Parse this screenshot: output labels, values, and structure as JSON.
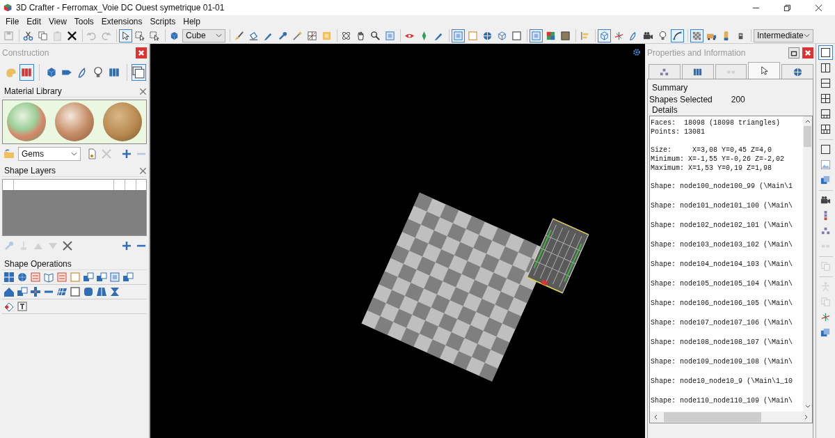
{
  "window": {
    "title": "3D Crafter - Ferromax_Voie DC Ouest symetrique 01-01"
  },
  "menu": [
    {
      "label": "File"
    },
    {
      "label": "Edit"
    },
    {
      "label": "View"
    },
    {
      "label": "Tools"
    },
    {
      "label": "Extensions"
    },
    {
      "label": "Scripts"
    },
    {
      "label": "Help"
    }
  ],
  "toolbar": [
    {
      "kind": "button",
      "selected": false,
      "disabled": true
    },
    {
      "kind": "separator"
    },
    {
      "kind": "button",
      "selected": false,
      "disabled": false
    },
    {
      "kind": "button",
      "selected": false,
      "disabled": false
    },
    {
      "kind": "button",
      "selected": false,
      "disabled": true
    },
    {
      "kind": "button",
      "selected": false,
      "disabled": false
    },
    {
      "kind": "separator"
    },
    {
      "kind": "button",
      "selected": false,
      "disabled": true
    },
    {
      "kind": "button",
      "selected": false,
      "disabled": true
    },
    {
      "kind": "separator"
    },
    {
      "kind": "button",
      "selected": true,
      "disabled": false
    },
    {
      "kind": "button",
      "selected": false,
      "disabled": false
    },
    {
      "kind": "button",
      "selected": false,
      "disabled": false
    },
    {
      "kind": "separator"
    },
    {
      "kind": "button",
      "selected": false,
      "disabled": false
    },
    {
      "kind": "dropdown",
      "value": "Cube"
    },
    {
      "kind": "separator"
    },
    {
      "kind": "button",
      "selected": false,
      "disabled": false
    },
    {
      "kind": "button",
      "selected": false,
      "disabled": false
    },
    {
      "kind": "button",
      "selected": false,
      "disabled": false
    },
    {
      "kind": "button",
      "selected": false,
      "disabled": false
    },
    {
      "kind": "button",
      "selected": false,
      "disabled": false
    },
    {
      "kind": "button",
      "selected": false,
      "disabled": false
    },
    {
      "kind": "button",
      "selected": false,
      "disabled": false
    },
    {
      "kind": "separator"
    },
    {
      "kind": "button",
      "selected": false,
      "disabled": false
    },
    {
      "kind": "button",
      "selected": false,
      "disabled": false
    },
    {
      "kind": "button",
      "selected": false,
      "disabled": false
    },
    {
      "kind": "button",
      "selected": false,
      "disabled": false
    },
    {
      "kind": "separator"
    },
    {
      "kind": "button",
      "selected": false,
      "disabled": false
    },
    {
      "kind": "button",
      "selected": false,
      "disabled": false
    },
    {
      "kind": "button",
      "selected": false,
      "disabled": false
    },
    {
      "kind": "separator"
    },
    {
      "kind": "button",
      "selected": true,
      "disabled": false
    },
    {
      "kind": "button",
      "selected": false,
      "disabled": false
    },
    {
      "kind": "button",
      "selected": false,
      "disabled": false
    },
    {
      "kind": "button",
      "selected": false,
      "disabled": false
    },
    {
      "kind": "button",
      "selected": false,
      "disabled": false
    },
    {
      "kind": "separator"
    },
    {
      "kind": "button",
      "selected": true,
      "disabled": false
    },
    {
      "kind": "button",
      "selected": false,
      "disabled": false
    },
    {
      "kind": "button",
      "selected": false,
      "disabled": false
    },
    {
      "kind": "separator"
    },
    {
      "kind": "button",
      "selected": false,
      "disabled": false
    },
    {
      "kind": "separator"
    },
    {
      "kind": "button",
      "selected": true,
      "disabled": false
    },
    {
      "kind": "button",
      "selected": false,
      "disabled": false
    },
    {
      "kind": "button",
      "selected": false,
      "disabled": false
    },
    {
      "kind": "button",
      "selected": false,
      "disabled": false
    },
    {
      "kind": "button",
      "selected": false,
      "disabled": false
    },
    {
      "kind": "button",
      "selected": true,
      "disabled": false
    },
    {
      "kind": "separator"
    },
    {
      "kind": "button",
      "selected": true,
      "disabled": false
    },
    {
      "kind": "button",
      "selected": false,
      "disabled": false
    },
    {
      "kind": "button",
      "selected": false,
      "disabled": false
    },
    {
      "kind": "button",
      "selected": false,
      "disabled": false
    },
    {
      "kind": "separator"
    },
    {
      "kind": "dropdown",
      "value": "Intermediate"
    }
  ],
  "construction": {
    "title": "Construction",
    "tools": [
      {
        "kind": "button",
        "selected": false
      },
      {
        "kind": "button",
        "selected": true
      },
      {
        "kind": "separator"
      },
      {
        "kind": "button",
        "selected": false
      },
      {
        "kind": "button",
        "selected": false
      },
      {
        "kind": "button",
        "selected": false
      },
      {
        "kind": "button",
        "selected": false
      },
      {
        "kind": "button",
        "selected": false
      },
      {
        "kind": "separator"
      },
      {
        "kind": "button",
        "selected": true
      }
    ],
    "material_library": {
      "title": "Material Library",
      "category": "Gems",
      "tools": [
        {
          "disabled": false
        },
        {
          "disabled": true
        },
        {
          "disabled": false
        },
        {
          "disabled": true
        }
      ]
    },
    "shape_layers": {
      "title": "Shape Layers",
      "tools": [
        {
          "disabled": true
        },
        {
          "disabled": true
        },
        {
          "disabled": true
        },
        {
          "disabled": true
        },
        {
          "disabled": false
        },
        {
          "disabled": false
        },
        {
          "disabled": false
        }
      ]
    },
    "shape_operations": {
      "title": "Shape Operations"
    }
  },
  "properties": {
    "title": "Properties and Information",
    "tabs": [
      {
        "selected": false,
        "disabled": false
      },
      {
        "selected": false,
        "disabled": false
      },
      {
        "selected": false,
        "disabled": true
      },
      {
        "selected": true,
        "disabled": false
      },
      {
        "selected": false,
        "disabled": false
      }
    ],
    "summary_label": "Summary",
    "shapes_selected_label": "Shapes Selected",
    "shapes_selected_value": "200",
    "details_label": "Details",
    "details": [
      {
        "lines": [
          "Faces:  18098 (18098 triangles)",
          "Points: 13081"
        ]
      },
      {
        "lines": [
          "Size:     X=3,08 Y=0,45 Z=4,0",
          "Minimum: X=-1,55 Y=-0,26 Z=-2,02",
          "Maximum: X=1,53 Y=0,19 Z=1,98"
        ]
      },
      {
        "lines": [
          "Shape: node100_node100_99 (\\Main\\1"
        ]
      },
      {
        "lines": [
          "Shape: node101_node101_100 (\\Main\\"
        ]
      },
      {
        "lines": [
          "Shape: node102_node102_101 (\\Main\\"
        ]
      },
      {
        "lines": [
          "Shape: node103_node103_102 (\\Main\\"
        ]
      },
      {
        "lines": [
          "Shape: node104_node104_103 (\\Main\\"
        ]
      },
      {
        "lines": [
          "Shape: node105_node105_104 (\\Main\\"
        ]
      },
      {
        "lines": [
          "Shape: node106_node106_105 (\\Main\\"
        ]
      },
      {
        "lines": [
          "Shape: node107_node107_106 (\\Main\\"
        ]
      },
      {
        "lines": [
          "Shape: node108_node108_107 (\\Main\\"
        ]
      },
      {
        "lines": [
          "Shape: node109_node109_108 (\\Main\\"
        ]
      },
      {
        "lines": [
          "Shape: node10_node10_9 (\\Main\\1_10"
        ]
      },
      {
        "lines": [
          "Shape: node110_node110_109 (\\Main\\"
        ]
      }
    ]
  },
  "view_strip": [
    {
      "kind": "button",
      "selected": true,
      "disabled": false
    },
    {
      "kind": "button",
      "selected": false,
      "disabled": false
    },
    {
      "kind": "button",
      "selected": false,
      "disabled": false
    },
    {
      "kind": "button",
      "selected": false,
      "disabled": false
    },
    {
      "kind": "button",
      "selected": false,
      "disabled": false
    },
    {
      "kind": "button",
      "selected": false,
      "disabled": false
    },
    {
      "kind": "separator"
    },
    {
      "kind": "button",
      "selected": false,
      "disabled": false
    },
    {
      "kind": "button",
      "selected": false,
      "disabled": false
    },
    {
      "kind": "button",
      "selected": false,
      "disabled": false
    },
    {
      "kind": "separator"
    },
    {
      "kind": "button",
      "selected": false,
      "disabled": false
    },
    {
      "kind": "button",
      "selected": false,
      "disabled": false
    },
    {
      "kind": "button",
      "selected": false,
      "disabled": false
    },
    {
      "kind": "button",
      "selected": false,
      "disabled": true
    },
    {
      "kind": "separator"
    },
    {
      "kind": "button",
      "selected": false,
      "disabled": true
    },
    {
      "kind": "separator"
    },
    {
      "kind": "button",
      "selected": false,
      "disabled": true
    },
    {
      "kind": "button",
      "selected": false,
      "disabled": true
    },
    {
      "kind": "button",
      "selected": false,
      "disabled": false
    },
    {
      "kind": "button",
      "selected": false,
      "disabled": false
    }
  ]
}
